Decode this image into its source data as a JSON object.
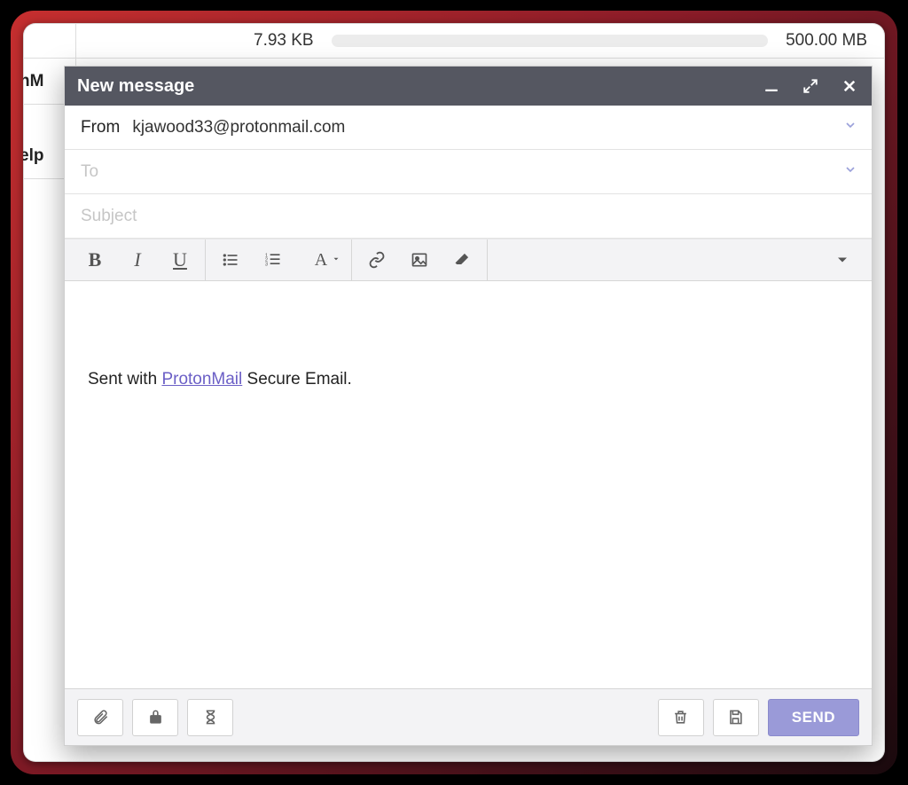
{
  "background": {
    "storage_used": "7.93 KB",
    "storage_total": "500.00 MB",
    "side_label_1": "nM",
    "side_label_2": "elp"
  },
  "compose": {
    "title": "New message",
    "from_label": "From",
    "from_value": "kjawood33@protonmail.com",
    "to_placeholder": "To",
    "subject_placeholder": "Subject",
    "body_prefix": "Sent with ",
    "body_link_text": "ProtonMail",
    "body_suffix": " Secure Email.",
    "send_label": "SEND"
  }
}
